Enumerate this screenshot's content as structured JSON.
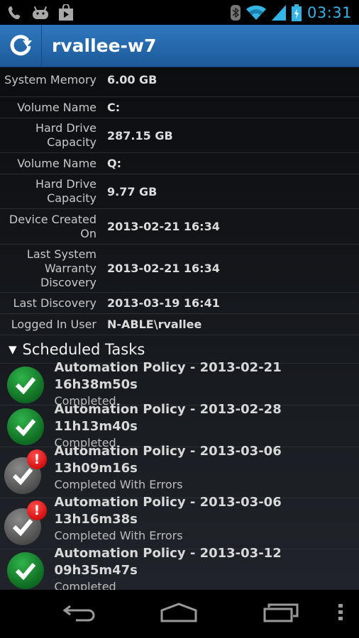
{
  "status_bar": {
    "left_icons": [
      "phone-icon",
      "android-icon",
      "play-store-icon"
    ],
    "right_icons": [
      "bluetooth-icon",
      "wifi-icon",
      "signal-icon",
      "battery-charging-icon"
    ],
    "time": "03:31",
    "accent_color": "#33b5e5"
  },
  "action_bar": {
    "refresh_icon": "refresh-icon",
    "title": "rvallee-w7",
    "color": "#2a6db0"
  },
  "device_info": [
    {
      "label": "System Memory",
      "value": "6.00 GB"
    },
    {
      "label": "Volume Name",
      "value": "C:"
    },
    {
      "label": "Hard Drive Capacity",
      "value": "287.15 GB"
    },
    {
      "label": "Volume Name",
      "value": "Q:"
    },
    {
      "label": "Hard Drive Capacity",
      "value": "9.77 GB"
    },
    {
      "label": "Device Created On",
      "value": "2013-02-21 16:34"
    },
    {
      "label": "Last System Warranty Discovery",
      "value": "2013-02-21 16:34"
    },
    {
      "label": "Last Discovery",
      "value": "2013-03-19 16:41"
    },
    {
      "label": "Logged In User",
      "value": "N-ABLE\\rvallee"
    }
  ],
  "scheduled_tasks": {
    "header": "Scheduled Tasks",
    "expanded": true,
    "items": [
      {
        "title": "Automation Policy - 2013-02-21 16h38m50s",
        "status": "Completed",
        "state": "ok"
      },
      {
        "title": "Automation Policy - 2013-02-28 11h13m40s",
        "status": "Completed",
        "state": "ok"
      },
      {
        "title": "Automation Policy - 2013-03-06 13h09m16s",
        "status": "Completed With Errors",
        "state": "error"
      },
      {
        "title": "Automation Policy - 2013-03-06 13h16m38s",
        "status": "Completed With Errors",
        "state": "error"
      },
      {
        "title": "Automation Policy - 2013-03-12 09h35m47s",
        "status": "Completed",
        "state": "ok"
      }
    ]
  },
  "nav_bar": {
    "buttons": [
      "back",
      "home",
      "recent-apps",
      "menu"
    ]
  },
  "status_colors": {
    "ok": "#1a8a30",
    "error": "#e01818",
    "neutral": "#5a5a5a"
  }
}
